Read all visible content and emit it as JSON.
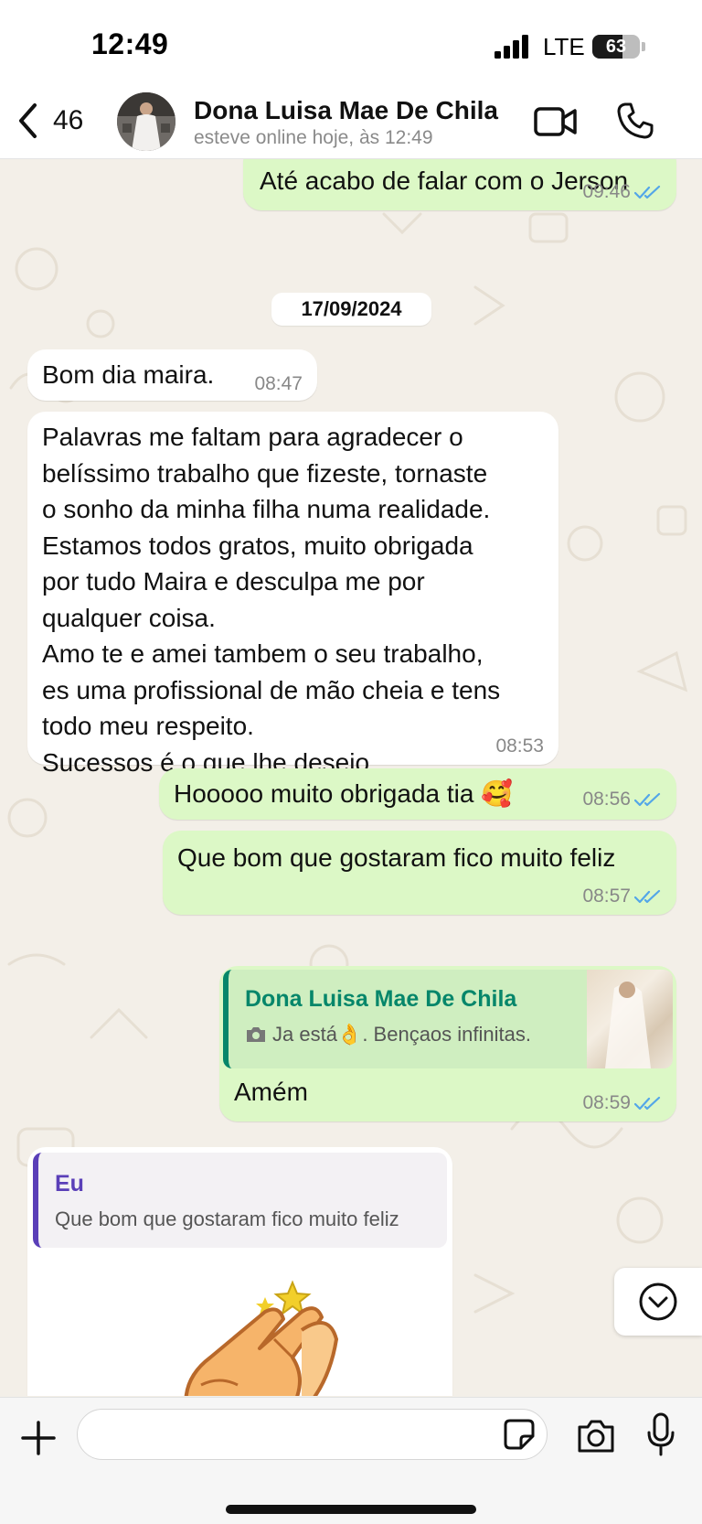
{
  "status_bar": {
    "time": "12:49",
    "network": "LTE",
    "battery": "63",
    "battery_level": 0.63
  },
  "header": {
    "back_count": "46",
    "contact_name": "Dona Luisa Mae De Chila",
    "contact_status": "esteve online hoje, às 12:49",
    "icons": [
      "chevron-left-icon",
      "video-call-icon",
      "phone-call-icon"
    ]
  },
  "chat": {
    "messages": [
      {
        "direction": "out",
        "text": "Até acabo de falar com o Jerson",
        "time": "09:46",
        "read": true
      },
      {
        "direction": "in",
        "text": "Bom dia maira.",
        "time": "08:47"
      },
      {
        "direction": "in",
        "text": "Palavras me faltam para agradecer o\nbelíssimo trabalho que fizeste, tornaste\no sonho da minha filha numa realidade.\nEstamos todos gratos, muito obrigada\npor tudo Maira e desculpa me por\nqualquer coisa.\nAmo te  e amei tambem  o seu trabalho,\nes uma profissional de mão cheia e tens\ntodo meu respeito.\nSucessos é o que lhe desejo.",
        "time": "08:53"
      },
      {
        "direction": "out",
        "text": "Hooooo muito obrigada  tia",
        "emoji": "🥰",
        "time": "08:56",
        "read": true
      },
      {
        "direction": "out",
        "text": "Que bom que gostaram fico muito feliz",
        "time": "08:57",
        "read": true
      },
      {
        "direction": "out",
        "text": "Amém",
        "time": "08:59",
        "read": true,
        "reply_to": {
          "author": "Dona Luisa Mae De Chila",
          "text": "Ja está👌. Bençaos infinitas.",
          "has_photo": true
        }
      },
      {
        "direction": "in",
        "type": "sticker",
        "sticker": "clapping-hands",
        "reply_to": {
          "author": "Eu",
          "text": "Que bom que gostaram fico muito feliz"
        }
      }
    ],
    "date_separator": "17/09/2024"
  },
  "input_bar": {
    "placeholder": ""
  },
  "colors": {
    "outgoing_bubble": "#dcf8c6",
    "incoming_bubble": "#ffffff",
    "read_ticks": "#53a6e8",
    "reply_accent_contact": "#06866a",
    "reply_accent_self": "#5a3fb8",
    "chat_background": "#f3efe8"
  }
}
